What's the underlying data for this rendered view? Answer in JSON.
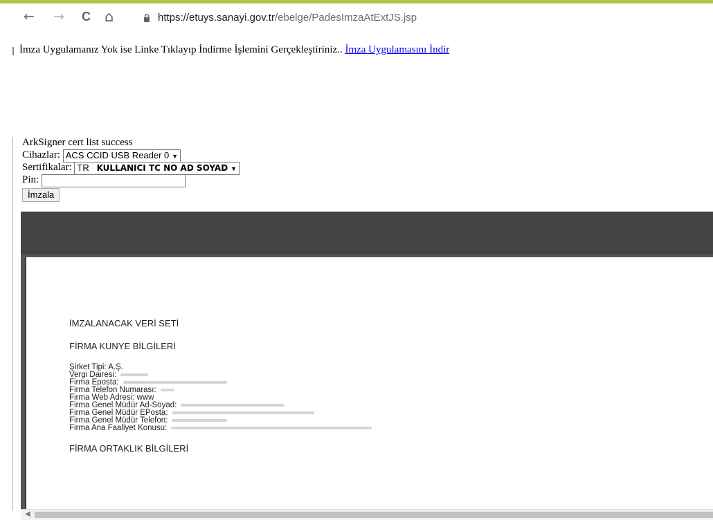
{
  "browser": {
    "back_icon": "←",
    "forward_icon": "→",
    "reload_icon": "C",
    "home_icon": "⌂",
    "url_host": "https://etuys.sanayi.gov.tr",
    "url_path": "/ebelge/PadesImzaAtExtJS.jsp"
  },
  "info": {
    "text": "İmza Uygulamanız Yok ise Linke Tıklayıp İndirme İşlemini Gerçekleştiriniz..",
    "link": "İmza Uygulamasını İndir"
  },
  "signer": {
    "status": "ArkSigner cert list success",
    "devices_label": "Cihazlar:",
    "devices_value": "ACS CCID USB Reader 0",
    "certs_label": "Sertifikalar:",
    "cert_prefix": "TR",
    "cert_value": "KULLANICI TC NO AD SOYAD",
    "pin_label": "Pin:",
    "sign_button": "İmzala"
  },
  "document": {
    "heading1": "İMZALANACAK VERİ SETİ",
    "heading2": "FİRMA KUNYE BİLGİLERİ",
    "lines": [
      "Şirket Tipi: A.Ş.",
      "Vergi Dairesi:",
      "Firma Eposta:",
      "Firma Telefon Numarası:",
      "Firma Web Adresi: www",
      "Firma Genel Müdür Ad-Soyad:",
      "Firma Genel Müdür EPosta:",
      "Firma Genel Müdür Telefon:",
      "Firma Ana Faaliyet Konusu:"
    ],
    "heading3": "FİRMA ORTAKLIK BİLGİLERİ"
  },
  "colors": {
    "top_accent": "#b5c34a",
    "link": "#0000ee",
    "viewer_bg": "#525659"
  }
}
